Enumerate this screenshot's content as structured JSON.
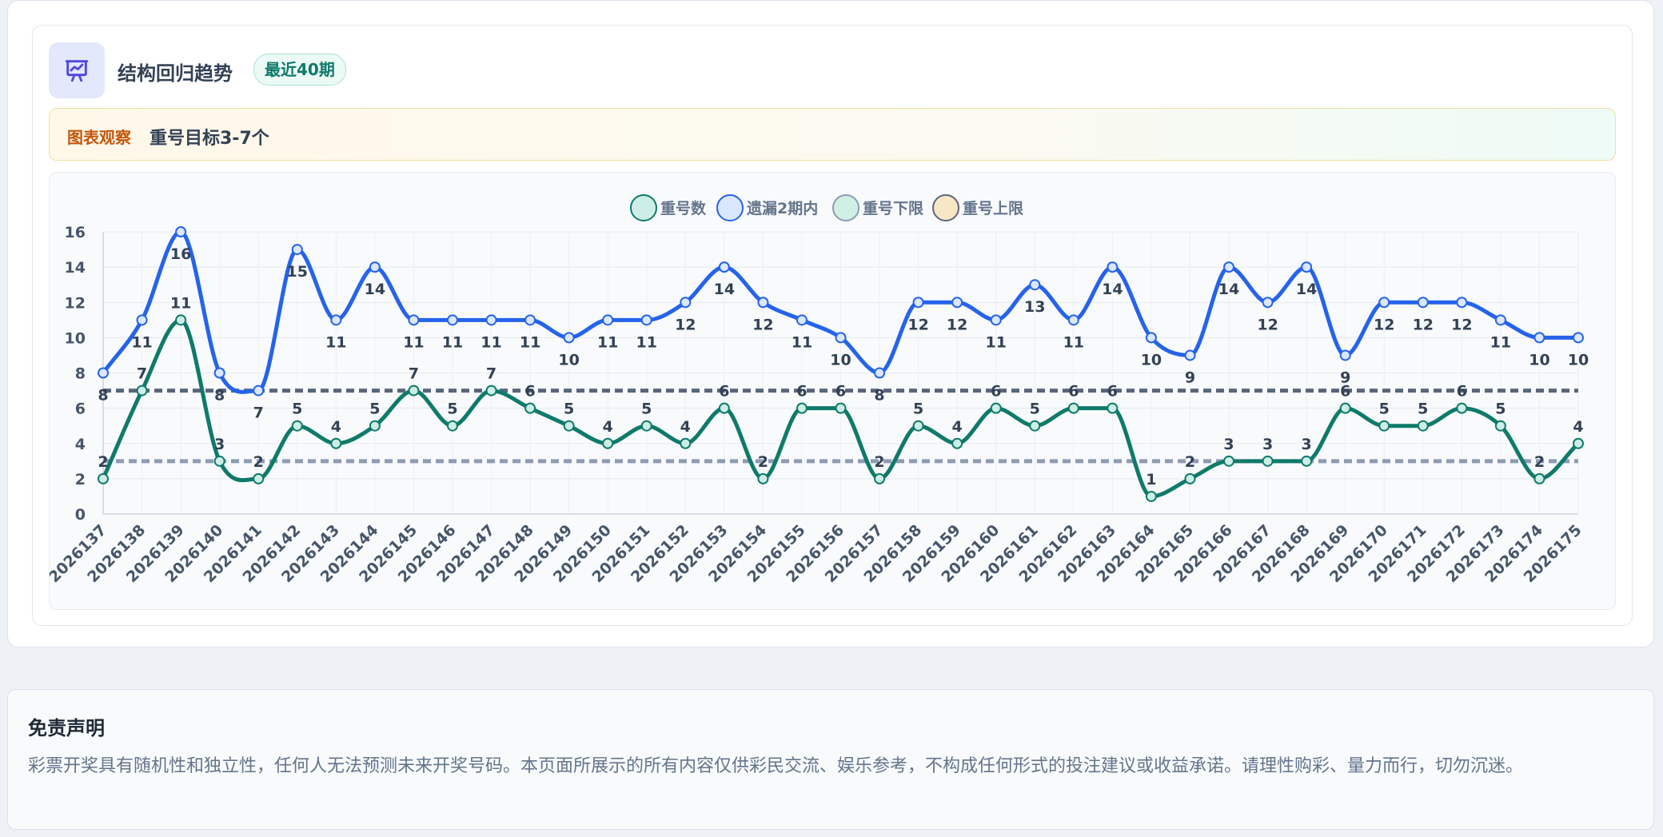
{
  "header": {
    "title": "结构回归趋势",
    "badge": "最近40期"
  },
  "observation": {
    "tag": "图表观察",
    "text": "重号目标3-7个"
  },
  "colors": {
    "repeat": "#0f7a6a",
    "miss2": "#2563eb",
    "lower": "#8f9bb3",
    "upper": "#5a657c",
    "repeat_legend_fill": "#cdeee6",
    "miss2_legend_fill": "#dbe7ff",
    "lower_legend_fill": "#d0f0e6",
    "upper_legend_fill": "#f8e7c4"
  },
  "chart_data": {
    "type": "line",
    "x": [
      "2026137",
      "2026138",
      "2026139",
      "2026140",
      "2026141",
      "2026142",
      "2026143",
      "2026144",
      "2026145",
      "2026146",
      "2026147",
      "2026148",
      "2026149",
      "2026150",
      "2026151",
      "2026152",
      "2026153",
      "2026154",
      "2026155",
      "2026156",
      "2026157",
      "2026158",
      "2026159",
      "2026160",
      "2026161",
      "2026162",
      "2026163",
      "2026164",
      "2026165",
      "2026166",
      "2026167",
      "2026168",
      "2026169",
      "2026170",
      "2026171",
      "2026172",
      "2026173",
      "2026174",
      "2026175"
    ],
    "series": [
      {
        "name": "重号数",
        "values": [
          2,
          7,
          11,
          3,
          2,
          5,
          4,
          5,
          7,
          5,
          7,
          6,
          5,
          4,
          5,
          4,
          6,
          2,
          6,
          6,
          2,
          5,
          4,
          6,
          5,
          6,
          6,
          1,
          2,
          3,
          3,
          3,
          6,
          5,
          5,
          6,
          5,
          2,
          4
        ]
      },
      {
        "name": "遗漏2期内",
        "values": [
          8,
          11,
          16,
          8,
          7,
          15,
          11,
          14,
          11,
          11,
          11,
          11,
          10,
          11,
          11,
          12,
          14,
          12,
          11,
          10,
          8,
          12,
          12,
          11,
          13,
          11,
          14,
          10,
          9,
          14,
          12,
          14,
          9,
          12,
          12,
          12,
          11,
          10,
          10
        ]
      },
      {
        "name": "重号下限",
        "value": 3,
        "style": "dashed"
      },
      {
        "name": "重号上限",
        "value": 7,
        "style": "dashed"
      }
    ],
    "ylim": [
      0,
      16
    ],
    "yticks": [
      0,
      2,
      4,
      6,
      8,
      10,
      12,
      14,
      16
    ],
    "legend_position": "top-center",
    "grid": true
  },
  "disclaimer": {
    "title": "免责声明",
    "text": "彩票开奖具有随机性和独立性，任何人无法预测未来开奖号码。本页面所展示的所有内容仅供彩民交流、娱乐参考，不构成任何形式的投注建议或收益承诺。请理性购彩、量力而行，切勿沉迷。"
  }
}
